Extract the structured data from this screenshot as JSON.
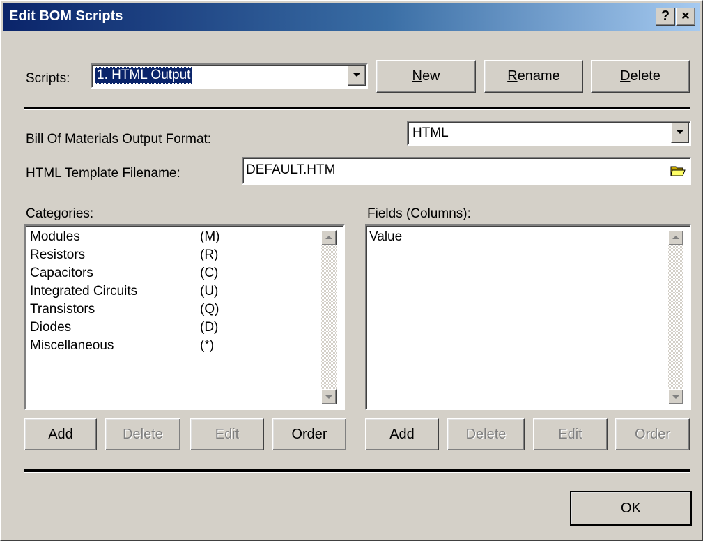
{
  "window": {
    "title": "Edit BOM Scripts",
    "help_label": "?",
    "close_label": "×"
  },
  "scripts": {
    "label": "Scripts:",
    "selected": "1. HTML Output",
    "new_label_first": "N",
    "new_label_rest": "ew",
    "rename_label_first": "R",
    "rename_label_rest": "ename",
    "delete_label_first": "D",
    "delete_label_rest": "elete"
  },
  "format": {
    "label": "Bill Of Materials Output Format:",
    "selected": "HTML"
  },
  "template": {
    "label": "HTML Template Filename:",
    "value": "DEFAULT.HTM"
  },
  "categories": {
    "label": "Categories:",
    "items": [
      {
        "name": "Modules",
        "code": "(M)"
      },
      {
        "name": "Resistors",
        "code": "(R)"
      },
      {
        "name": "Capacitors",
        "code": "(C)"
      },
      {
        "name": "Integrated Circuits",
        "code": "(U)"
      },
      {
        "name": "Transistors",
        "code": "(Q)"
      },
      {
        "name": "Diodes",
        "code": "(D)"
      },
      {
        "name": "Miscellaneous",
        "code": "(*)"
      }
    ],
    "buttons": {
      "add": "Add",
      "delete": "Delete",
      "edit": "Edit",
      "order": "Order"
    }
  },
  "fields": {
    "label": "Fields (Columns):",
    "items": [
      {
        "name": "Value"
      }
    ],
    "buttons": {
      "add": "Add",
      "delete": "Delete",
      "edit": "Edit",
      "order": "Order"
    }
  },
  "footer": {
    "ok_label": "OK"
  }
}
